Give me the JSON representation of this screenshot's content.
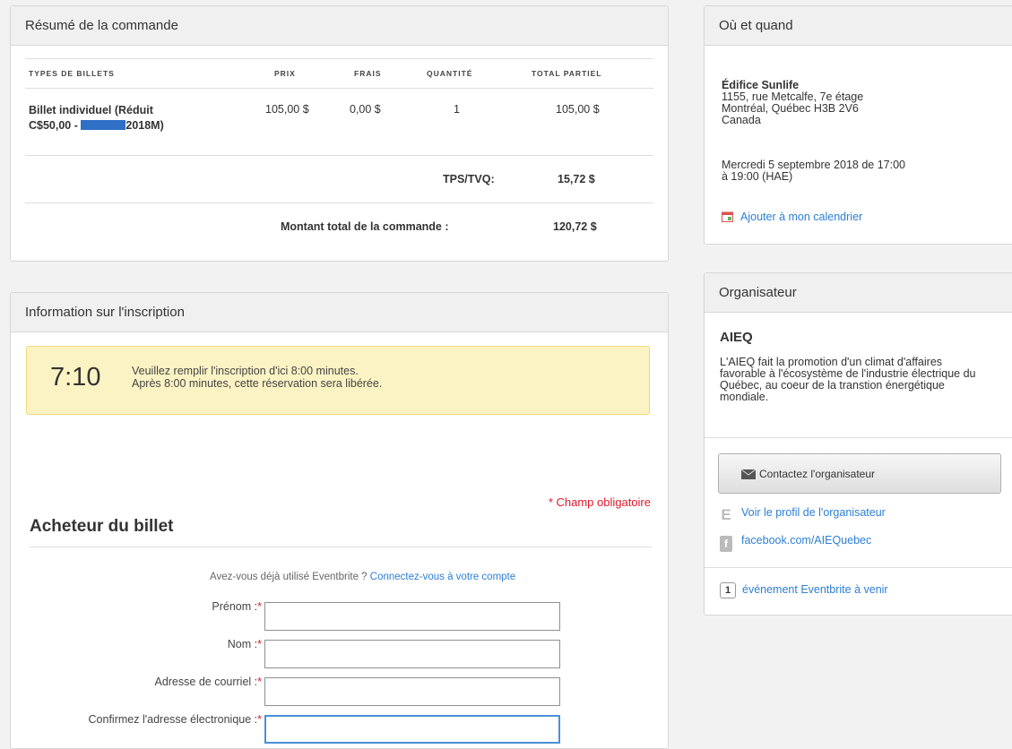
{
  "order": {
    "title": "Résumé de la commande",
    "headers": {
      "type": "TYPES DE BILLETS",
      "price": "PRIX",
      "fees": "FRAIS",
      "qty": "QUANTITÉ",
      "subtotal": "TOTAL PARTIEL"
    },
    "row": {
      "name_line1": "Billet individuel (Réduit",
      "name_line2_pre": "C$50,00 - ",
      "name_line2_post": "2018M)",
      "price": "105,00 $",
      "fees": "0,00 $",
      "qty": "1",
      "subtotal": "105,00 $"
    },
    "tax_label": "TPS/TVQ:",
    "tax_value": "15,72 $",
    "total_label": "Montant total de la commande :",
    "total_value": "120,72 $",
    "redaction_color": "#2f6fc6"
  },
  "registration": {
    "title": "Information sur l'inscription",
    "timer": "7:10",
    "timer_msg1": "Veuillez remplir l'inscription d'ici 8:00 minutes.",
    "timer_msg2": "Après 8:00 minutes, cette réservation sera libérée.",
    "required_note": "* Champ obligatoire",
    "buyer_title": "Acheteur du billet",
    "login_prompt": "Avez-vous déjà utilisé Eventbrite ?",
    "login_link": "Connectez-vous à votre compte",
    "fields": [
      {
        "label": "Prénom :",
        "value": ""
      },
      {
        "label": "Nom :",
        "value": ""
      },
      {
        "label": "Adresse de courriel :",
        "value": ""
      },
      {
        "label": "Confirmez l'adresse électronique :",
        "value": ""
      }
    ]
  },
  "where": {
    "title": "Où et quand",
    "venue_name": "Édifice Sunlife",
    "address1": "1155, rue Metcalfe, 7e étage",
    "address2": "Montréal, Québec H3B 2V6",
    "country": "Canada",
    "date": "Mercredi 5 septembre 2018 de 17:00 à 19:00 (HAE)",
    "calendar_link": "Ajouter à mon calendrier"
  },
  "organizer": {
    "title": "Organisateur",
    "name": "AIEQ",
    "description": "L'AIEQ fait la promotion d'un climat d'affaires favorable à l'écosystème de l'industrie électrique du Québec, au coeur de la transtion énergétique mondiale.",
    "contact_button": "Contactez l'organisateur",
    "profile_link": "Voir le profil de l'organisateur",
    "facebook_link": "facebook.com/AIEQuebec",
    "events_count": "1",
    "events_label": "événement Eventbrite à venir"
  },
  "icons": {
    "calendar": "calendar-icon",
    "envelope": "envelope-icon",
    "eventbrite": "eventbrite-icon",
    "facebook": "facebook-icon"
  },
  "colors": {
    "link": "#2d7fd3",
    "required": "#e0192b",
    "timer_bg": "#fcf3c4",
    "focus": "#4a90d9"
  }
}
